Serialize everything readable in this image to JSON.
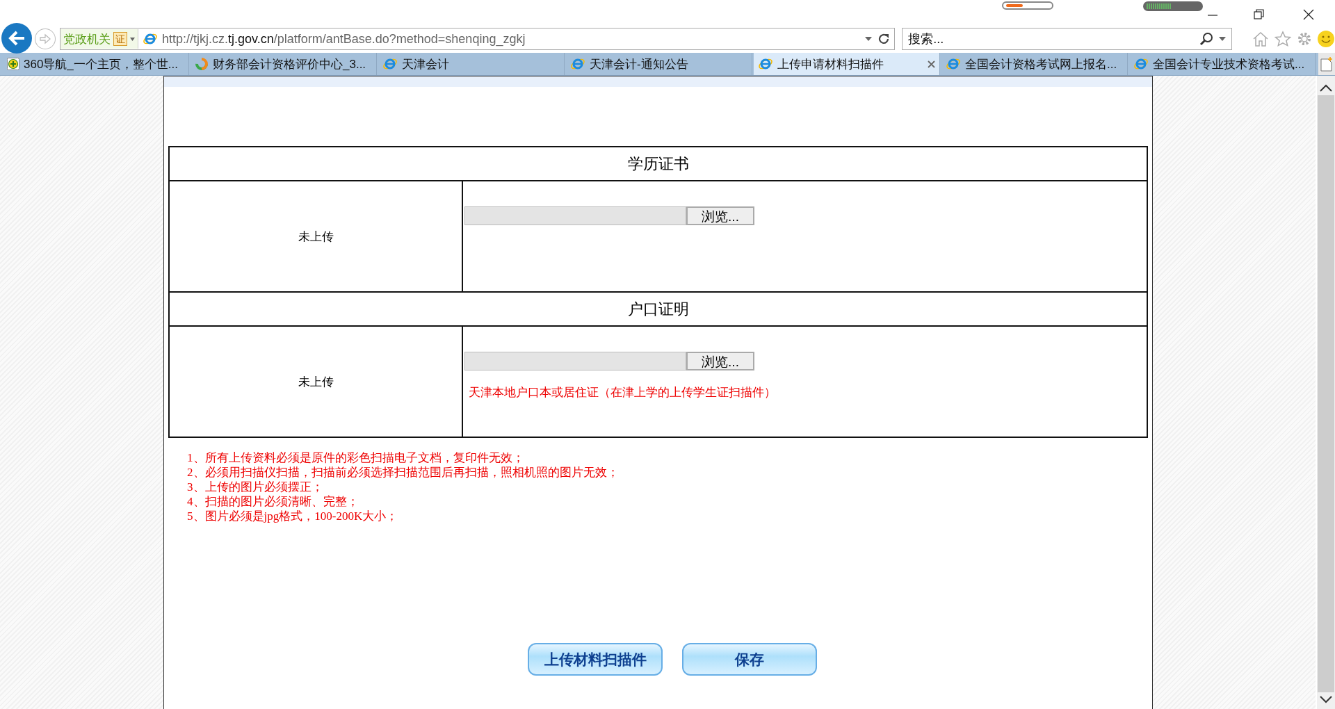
{
  "browser": {
    "zone_badge": "党政机关",
    "cert_badge": "证",
    "url": "http://tjkj.cz.**tj.gov.cn**/platform/antBase.do?method=shenqing_zgkj",
    "search": {
      "placeholder": "搜索..."
    }
  },
  "tabs": [
    {
      "label": "360导航_一个主页，整个世...",
      "kind": "plus",
      "selected": false
    },
    {
      "label": "财务部会计资格评价中心_3...",
      "kind": "ring",
      "selected": false
    },
    {
      "label": "天津会计",
      "kind": "ie",
      "selected": false
    },
    {
      "label": "天津会计-通知公告",
      "kind": "ie",
      "selected": false
    },
    {
      "label": "上传申请材料扫描件",
      "kind": "ie",
      "selected": true
    },
    {
      "label": "全国会计资格考试网上报名...",
      "kind": "ie",
      "selected": false
    },
    {
      "label": "全国会计专业技术资格考试...",
      "kind": "ie",
      "selected": false
    }
  ],
  "sections": [
    {
      "title": "学历证书",
      "status": "未上传",
      "browse": "浏览..."
    },
    {
      "title": "户口证明",
      "status": "未上传",
      "browse": "浏览...",
      "note": "天津本地户口本或居住证（在津上学的上传学生证扫描件）"
    }
  ],
  "notes": [
    "1、所有上传资料必须是原件的彩色扫描电子文档，复印件无效；",
    "2、必须用扫描仪扫描，扫描前必须选择扫描范围后再扫描，照相机照的图片无效；",
    "3、上传的图片必须摆正；",
    "4、扫描的图片必须清晰、完整；",
    "5、图片必须是jpg格式，100-200K大小；"
  ],
  "buttons": [
    "上传材料扫描件",
    "保存"
  ]
}
